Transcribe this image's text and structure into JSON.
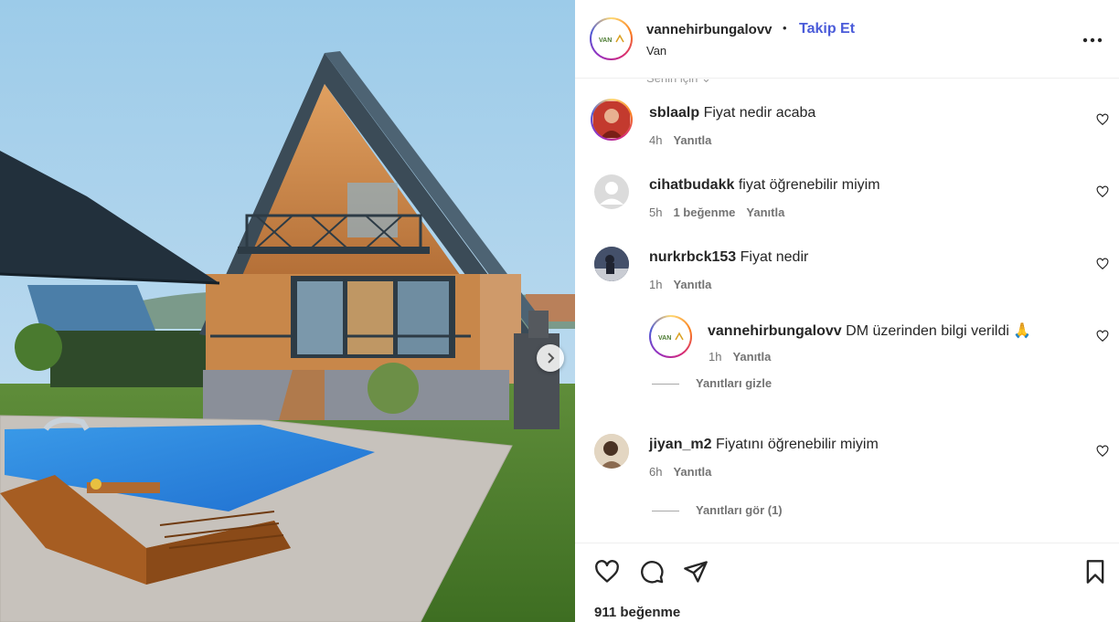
{
  "post": {
    "username": "vannehirbungalovv",
    "separator": "•",
    "follow_label": "Takip Et",
    "location": "Van",
    "more_label": "•••",
    "likes_text": "911 beğenme"
  },
  "comments_header": {
    "sort_label": "Senin için ⌄"
  },
  "comments": [
    {
      "user": "sblaalp",
      "text": "Fiyat nedir acaba",
      "time": "4h",
      "likes": "",
      "reply_label": "Yanıtla"
    },
    {
      "user": "cihatbudakk",
      "text": "fiyat öğrenebilir miyim",
      "time": "5h",
      "likes": "1 beğenme",
      "reply_label": "Yanıtla"
    },
    {
      "user": "nurkrbck153",
      "text": "Fiyat nedir",
      "time": "1h",
      "likes": "",
      "reply_label": "Yanıtla"
    },
    {
      "user": "jiyan_m2",
      "text": "Fiyatını öğrenebilir miyim",
      "time": "6h",
      "likes": "",
      "reply_label": "Yanıtla"
    }
  ],
  "reply": {
    "user": "vannehirbungalovv",
    "text": "DM üzerinden bilgi verildi 🙏",
    "time": "1h",
    "reply_label": "Yanıtla"
  },
  "toggles": {
    "hide_replies": "Yanıtları gizle",
    "show_replies": "Yanıtları gör (1)"
  },
  "colors": {
    "follow": "#4a5bd9",
    "muted": "#737373",
    "text": "#262626"
  },
  "icons": {
    "like": "heart-icon",
    "comment": "comment-icon",
    "share": "send-icon",
    "save": "bookmark-icon",
    "next": "chevron-right-icon"
  }
}
